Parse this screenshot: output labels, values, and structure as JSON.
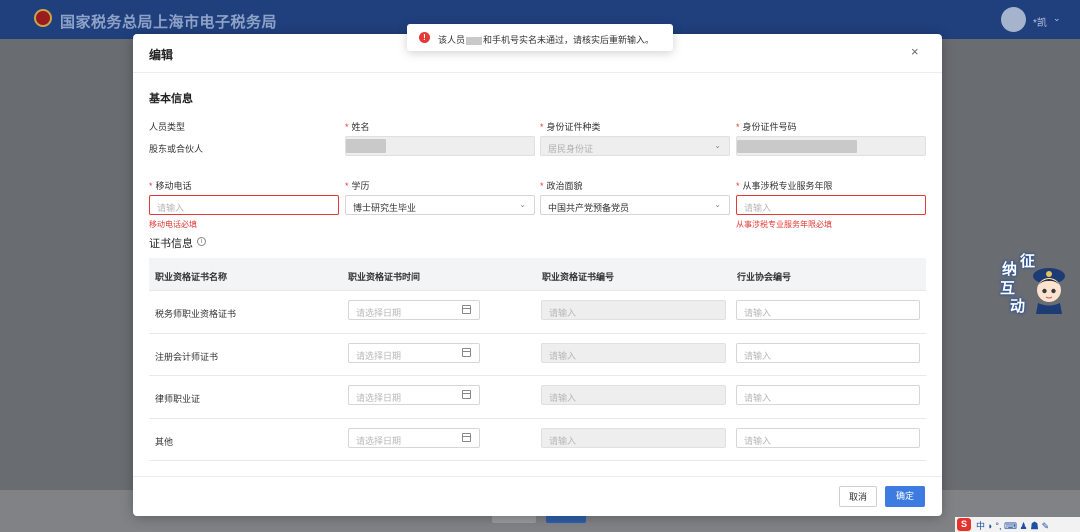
{
  "site": {
    "title": "国家税务总局上海市电子税务局",
    "user_name": "*凯",
    "user_caret": "⌄"
  },
  "modal": {
    "title": "编辑",
    "close": "×",
    "basic_section": "基本信息",
    "fields_row1": {
      "person_type_label": "人员类型",
      "person_type_value": "股东或合伙人",
      "name_label": "姓名",
      "id_type_label": "身份证件种类",
      "id_type_value": "居民身份证",
      "id_number_label": "身份证件号码"
    },
    "fields_row2": {
      "mobile_label": "移动电话",
      "mobile_placeholder": "请输入",
      "mobile_error": "移动电话必填",
      "education_label": "学历",
      "education_value": "博士研究生毕业",
      "political_label": "政治面貌",
      "political_value": "中国共产党预备党员",
      "years_label": "从事涉税专业服务年限",
      "years_placeholder": "请输入",
      "years_error": "从事涉税专业服务年限必填"
    },
    "cert_section": "证书信息",
    "cert_table": {
      "headers": [
        "职业资格证书名称",
        "职业资格证书时间",
        "职业资格证书编号",
        "行业协会编号"
      ],
      "rows": [
        {
          "name": "税务师职业资格证书",
          "date_placeholder": "请选择日期",
          "number_placeholder": "请输入",
          "assoc_placeholder": "请输入"
        },
        {
          "name": "注册会计师证书",
          "date_placeholder": "请选择日期",
          "number_placeholder": "请输入",
          "assoc_placeholder": "请输入"
        },
        {
          "name": "律师职业证",
          "date_placeholder": "请选择日期",
          "number_placeholder": "请输入",
          "assoc_placeholder": "请输入"
        },
        {
          "name": "其他",
          "date_placeholder": "请选择日期",
          "number_placeholder": "请输入",
          "assoc_placeholder": "请输入"
        }
      ]
    },
    "cancel_label": "取消",
    "ok_label": "确定"
  },
  "toast": {
    "icon": "!",
    "text_before": "该人员",
    "text_after": "和手机号实名未通过，请核实后重新输入。"
  },
  "mascot": {
    "chars": [
      "纳",
      "征",
      "互",
      "动"
    ]
  },
  "ime": {
    "logo": "S",
    "text": "中 ◗ °, ⌨ ♟ ☗ ✎"
  },
  "colors": {
    "header": "#1f3f7d",
    "primary": "#3d7be0",
    "error": "#e53935"
  }
}
